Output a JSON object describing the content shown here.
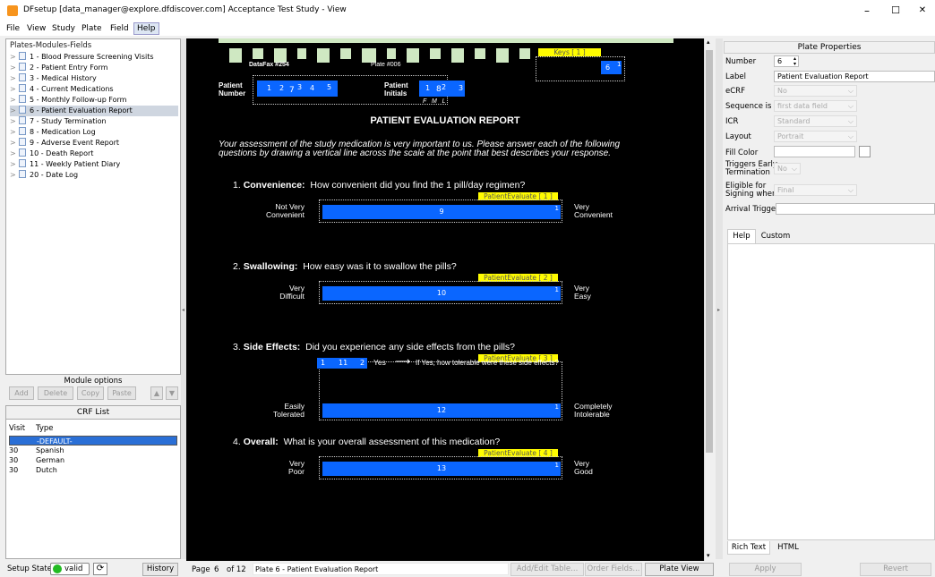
{
  "window": {
    "title": "DFsetup [data_manager@explore.dfdiscover.com] Acceptance Test Study - View",
    "minimize": "–",
    "maximize": "☐",
    "close": "✕"
  },
  "menu": [
    "File",
    "View",
    "Study",
    "Plate",
    "Field",
    "Help"
  ],
  "tree": {
    "header": "Plates-Modules-Fields",
    "items": [
      "1 - Blood Pressure Screening Visits",
      "2 - Patient Entry Form",
      "3 - Medical History",
      "4 - Current Medications",
      "5 - Monthly Follow-up Form",
      "6 - Patient Evaluation Report",
      "7 - Study Termination",
      "8 - Medication Log",
      "9 - Adverse Event Report",
      "10 - Death Report",
      "11 - Weekly Patient Diary",
      "20 - Date Log"
    ],
    "selected_index": 5
  },
  "module_options": {
    "title": "Module options",
    "buttons": [
      "Add",
      "Delete",
      "Copy",
      "Paste"
    ],
    "up": "▲",
    "down": "▼"
  },
  "crf_list": {
    "title": "CRF List",
    "columns": [
      "Visit",
      "Type"
    ],
    "rows": [
      {
        "visit": "",
        "type": "-DEFAULT-"
      },
      {
        "visit": "30",
        "type": "Spanish"
      },
      {
        "visit": "30",
        "type": "German"
      },
      {
        "visit": "30",
        "type": "Dutch"
      }
    ]
  },
  "setup": {
    "label": "Setup State:",
    "state": "valid",
    "history": "History",
    "refresh": "⟳"
  },
  "plate": {
    "datafax": "DataFax #254",
    "plate_no": "Plate #006",
    "keys": "Keys [ 1 ]",
    "key_field": "6",
    "key_sup": "1",
    "patient_number_l1": "Patient",
    "patient_number_l2": "Number",
    "pn_digits": [
      "1",
      "2",
      "7",
      "3",
      "4",
      "5"
    ],
    "patient_initials_l1": "Patient",
    "patient_initials_l2": "Initials",
    "pi_digits": [
      "1",
      "8",
      "2",
      "3"
    ],
    "fml": "F   M   L",
    "heading": "PATIENT EVALUATION REPORT",
    "intro1": "Your assessment of the study medication is very important to us. Please answer each of the following",
    "intro2": "questions by drawing a vertical line across the scale at the point that best describes your response.",
    "questions": [
      {
        "num": "1.",
        "title": "Convenience:",
        "text": "How convenient did you find the 1 pill/day regimen?",
        "tag": "PatientEvaluate [ 1 ]",
        "left1": "Not Very",
        "left2": "Convenient",
        "right1": "Very",
        "right2": "Convenient",
        "field": "9"
      },
      {
        "num": "2.",
        "title": "Swallowing:",
        "text": "How easy was it to swallow the pills?",
        "tag": "PatientEvaluate [ 2 ]",
        "left1": "Very",
        "left2": "Difficult",
        "right1": "Very",
        "right2": "Easy",
        "field": "10"
      },
      {
        "num": "3.",
        "title": "Side Effects:",
        "text": "Did you experience any side effects from the pills?",
        "tag": "PatientEvaluate [ 3 ]",
        "left1": "Easily",
        "left2": "Tolerated",
        "right1": "Completely",
        "right2": "Intolerable",
        "field": "12"
      },
      {
        "num": "4.",
        "title": "Overall:",
        "text": "What is your overall assessment of this medication?",
        "tag": "PatientEvaluate [ 4 ]",
        "left1": "Very",
        "left2": "Poor",
        "right1": "Very",
        "right2": "Good",
        "field": "13"
      }
    ],
    "side_choice": {
      "a": "1",
      "b": "11",
      "c": "2",
      "yes": "Yes",
      "arrow": "⟶",
      "followup": "If Yes, how tolerable were these side effects?"
    },
    "scale_end": "1"
  },
  "statusbar": {
    "page_label": "Page",
    "page": "6",
    "of": "of 12",
    "plate_name": "Plate 6 - Patient Evaluation Report",
    "add_table": "Add/Edit Table...",
    "order_fields": "Order Fields...",
    "plate_view": "Plate View"
  },
  "properties": {
    "title": "Plate Properties",
    "number_label": "Number",
    "number": "6",
    "label_label": "Label",
    "label": "Patient Evaluation Report",
    "ecrf_label": "eCRF",
    "ecrf": "No",
    "seq_label": "Sequence is",
    "seq": "first data field",
    "icr_label": "ICR",
    "icr": "Standard",
    "layout_label": "Layout",
    "layout": "Portrait",
    "fill_label": "Fill Color",
    "fill": "",
    "trig_label1": "Triggers Early",
    "trig_label2": "Termination",
    "trig": "No",
    "elig_label1": "Eligible for",
    "elig_label2": "Signing when",
    "elig": "Final",
    "arrival_label": "Arrival Trigger",
    "arrival": "",
    "tabs": [
      "Help",
      "Custom"
    ],
    "bottom_tabs": [
      "Rich Text",
      "HTML"
    ],
    "apply": "Apply",
    "revert": "Revert"
  },
  "colors": {
    "field_blue": "#0a66ff",
    "tag_yellow": "#fffc00",
    "valid_green": "#22bb22",
    "selection": "#2a6fd6"
  }
}
